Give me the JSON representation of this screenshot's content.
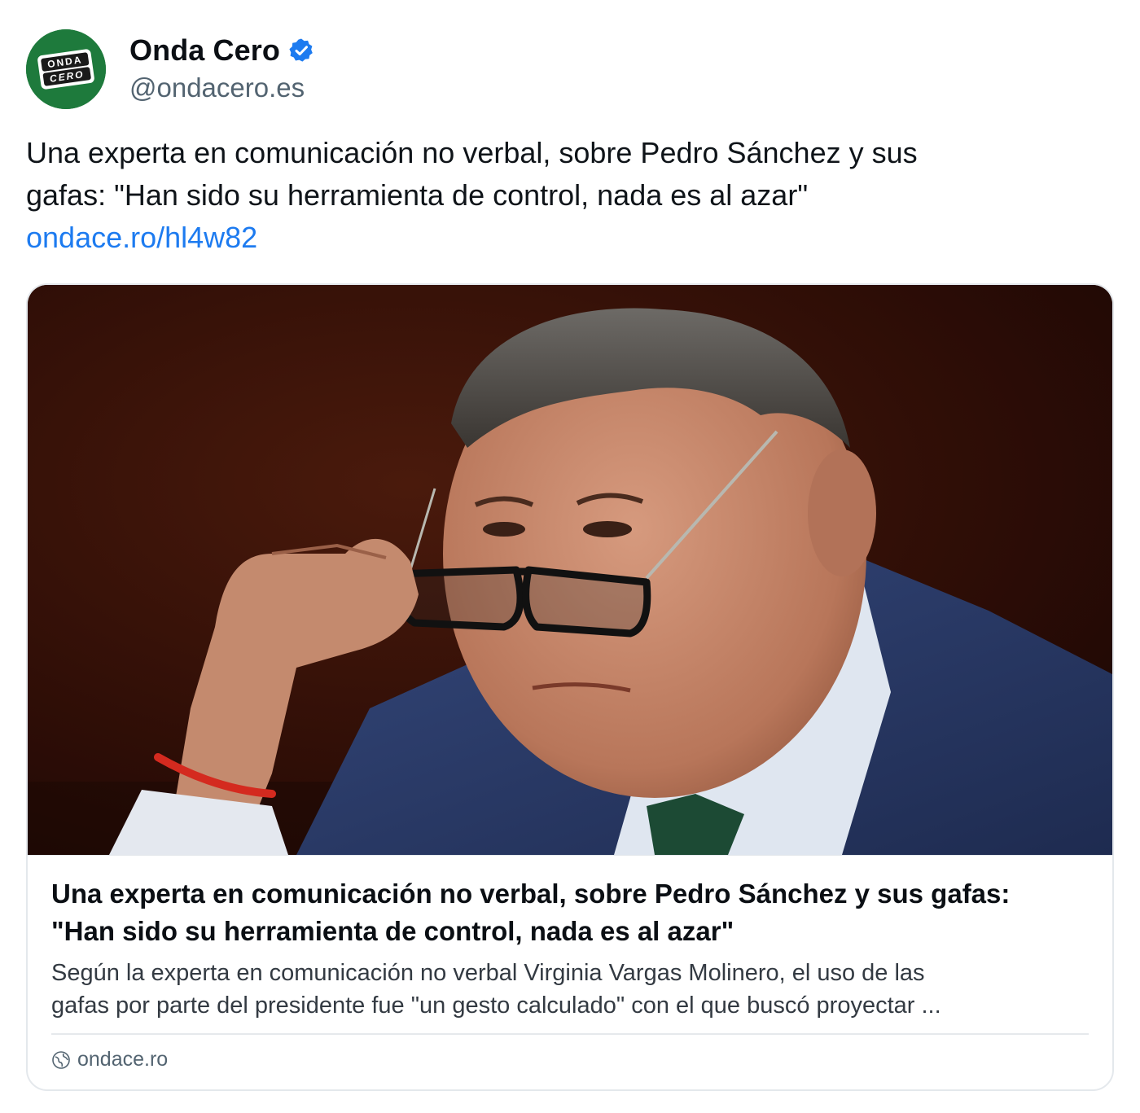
{
  "author": {
    "display_name": "Onda Cero",
    "handle": "@ondacero.es",
    "verified": true,
    "logo_text_top": "ONDA",
    "logo_text_bottom": "CERO",
    "avatar_color": "#1e7a3c",
    "verified_color": "#1d7bf0"
  },
  "post": {
    "text_line1": "Una experta en comunicación no verbal, sobre Pedro Sánchez y sus",
    "text_line2": "gafas: \"Han sido su herramienta de control, nada es al azar\"",
    "link_text": "ondace.ro/hl4w82",
    "link_color": "#1d7bf0"
  },
  "card": {
    "title_line1": "Una experta en comunicación no verbal, sobre Pedro Sánchez y sus gafas:",
    "title_line2": "\"Han sido su herramienta de control, nada es al azar\"",
    "description_line1": "Según la experta en comunicación no verbal Virginia Vargas Molinero, el uso de las",
    "description_line2": "gafas por parte del presidente fue \"un gesto calculado\" con el que buscó proyectar ...",
    "domain": "ondace.ro",
    "domain_icon": "globe-icon"
  }
}
